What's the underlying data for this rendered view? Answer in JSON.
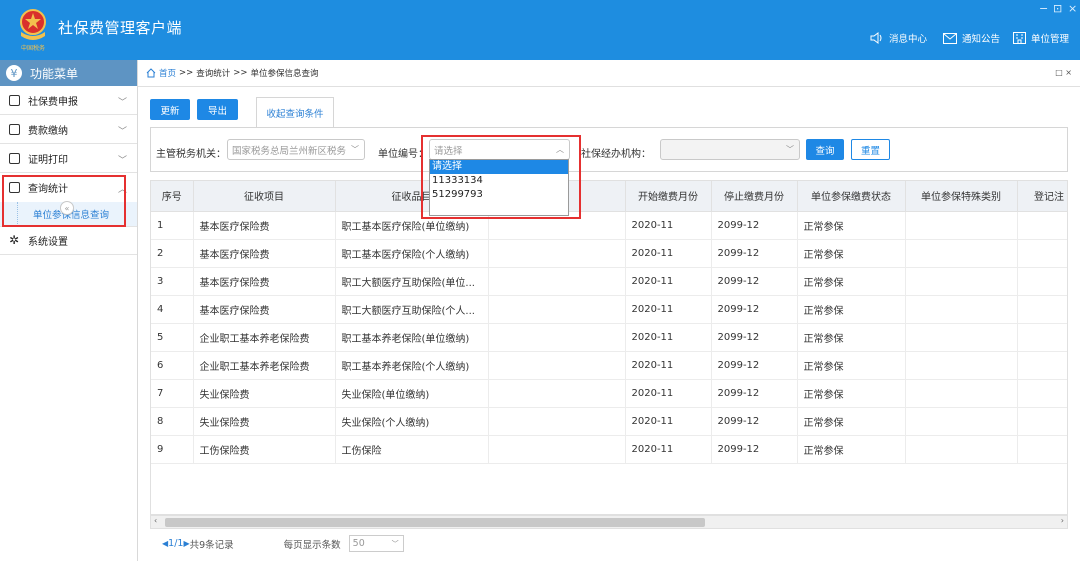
{
  "app": {
    "title": "社保费管理客户端",
    "logo_text": "中国税务"
  },
  "header": {
    "window_controls": [
      "−",
      "⊡",
      "×"
    ],
    "links": [
      {
        "label": "消息中心",
        "icon": "speaker-icon"
      },
      {
        "label": "通知公告",
        "icon": "mail-icon"
      },
      {
        "label": "单位管理",
        "icon": "building-icon"
      }
    ]
  },
  "sidebar": {
    "title": "功能菜单",
    "items": [
      {
        "label": "社保费申报",
        "icon": "calendar-icon"
      },
      {
        "label": "费款缴纳",
        "icon": "card-icon"
      },
      {
        "label": "证明打印",
        "icon": "printer-icon"
      },
      {
        "label": "查询统计",
        "icon": "chart-icon",
        "expanded": true
      },
      {
        "label": "系统设置",
        "icon": "gear-icon"
      }
    ],
    "sub_items": [
      "单位参保信息查询"
    ],
    "collapse_label": "«"
  },
  "breadcrumb": {
    "home": "首页",
    "sep1": ">>",
    "level1": "查询统计",
    "sep2": ">>",
    "level2": "单位参保信息查询",
    "close": "□ ×"
  },
  "toolbar": {
    "refresh_label": "更新",
    "export_label": "导出",
    "toggle_tab_label": "收起查询条件"
  },
  "filters": {
    "tax_office_label": "主管税务机关：",
    "tax_office_value": "国家税务总局兰州新区税务",
    "unit_no_label": "单位编号：",
    "unit_no_placeholder": "请选择",
    "agency_label": "社保经办机构：",
    "agency_value": "",
    "query_label": "查询",
    "reset_label": "重置"
  },
  "dropdown": {
    "options": [
      "请选择",
      "11333134",
      "51299793"
    ],
    "selected_index": 0
  },
  "table": {
    "columns": [
      "序号",
      "征收项目",
      "征收品目",
      "",
      "开始缴费月份",
      "停止缴费月份",
      "单位参保缴费状态",
      "单位参保特殊类别",
      "登记注"
    ],
    "rows": [
      [
        "1",
        "基本医疗保险费",
        "职工基本医疗保险(单位缴纳)",
        "",
        "2020-11",
        "2099-12",
        "正常参保",
        "",
        ""
      ],
      [
        "2",
        "基本医疗保险费",
        "职工基本医疗保险(个人缴纳)",
        "",
        "2020-11",
        "2099-12",
        "正常参保",
        "",
        ""
      ],
      [
        "3",
        "基本医疗保险费",
        "职工大额医疗互助保险(单位...",
        "",
        "2020-11",
        "2099-12",
        "正常参保",
        "",
        ""
      ],
      [
        "4",
        "基本医疗保险费",
        "职工大额医疗互助保险(个人...",
        "",
        "2020-11",
        "2099-12",
        "正常参保",
        "",
        ""
      ],
      [
        "5",
        "企业职工基本养老保险费",
        "职工基本养老保险(单位缴纳)",
        "",
        "2020-11",
        "2099-12",
        "正常参保",
        "",
        ""
      ],
      [
        "6",
        "企业职工基本养老保险费",
        "职工基本养老保险(个人缴纳)",
        "",
        "2020-11",
        "2099-12",
        "正常参保",
        "",
        ""
      ],
      [
        "7",
        "失业保险费",
        "失业保险(单位缴纳)",
        "",
        "2020-11",
        "2099-12",
        "正常参保",
        "",
        ""
      ],
      [
        "8",
        "失业保险费",
        "失业保险(个人缴纳)",
        "",
        "2020-11",
        "2099-12",
        "正常参保",
        "",
        ""
      ],
      [
        "9",
        "工伤保险费",
        "工伤保险",
        "",
        "2020-11",
        "2099-12",
        "正常参保",
        "",
        ""
      ]
    ]
  },
  "pager": {
    "prev": "◀",
    "page": "1/1",
    "next": "▶",
    "total": "共9条记录",
    "per_page_label": "每页显示条数",
    "per_page_value": "50"
  },
  "colors": {
    "title_bar": "#1e8de0",
    "sidebar_header": "#5e94c3",
    "primary_button": "#1e88e5",
    "highlight_border": "#e53030"
  }
}
